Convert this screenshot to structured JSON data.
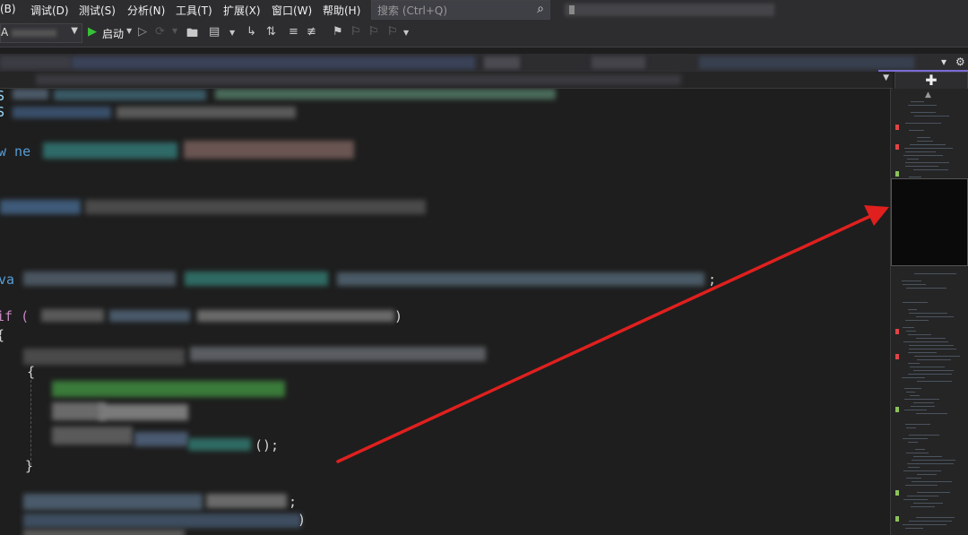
{
  "menubar": {
    "items": [
      "(B)",
      "调试(D)",
      "测试(S)",
      "分析(N)",
      "工具(T)",
      "扩展(X)",
      "窗口(W)",
      "帮助(H)"
    ],
    "search_placeholder": "搜索 (Ctrl+Q)"
  },
  "toolbar": {
    "config_value": "A",
    "start_label": "启动"
  },
  "editor": {
    "code_fragments": {
      "line_s1": "S",
      "line_s2": "S",
      "new_kw": "w ne",
      "var_kw": "va",
      "if_kw": "if (",
      "brace_open": "{",
      "inner_open": "{",
      "inner_close": "}",
      "call_end": "();",
      "semicolon": ";",
      "paren_close": ")"
    }
  },
  "scrollmap": {
    "marker_colors": {
      "error": "#e04545",
      "change": "#8dc25b"
    }
  },
  "annotation": {
    "arrow_color": "#e0201e"
  }
}
